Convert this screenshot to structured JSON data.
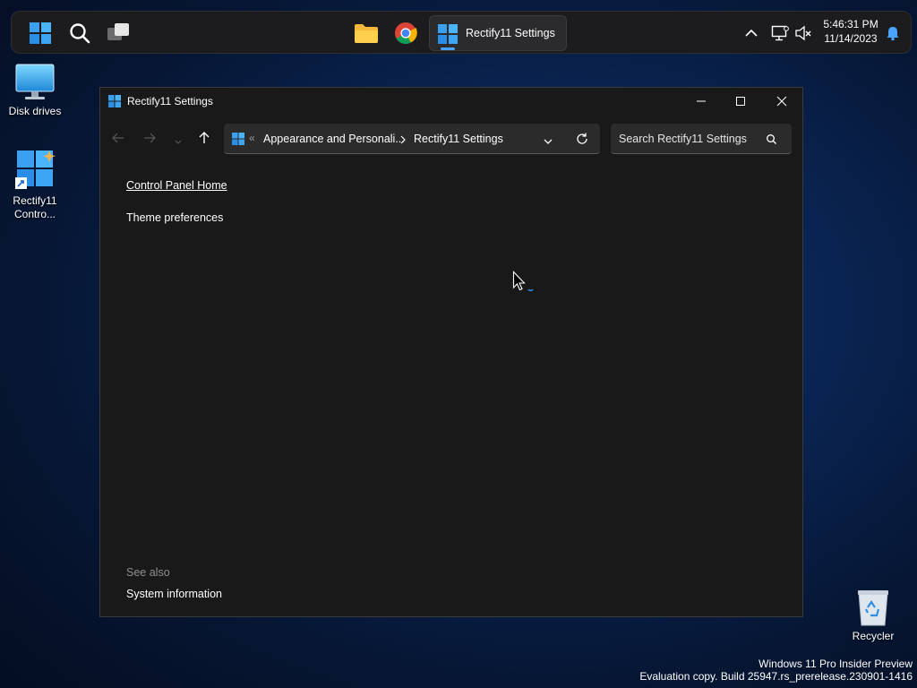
{
  "taskbar": {
    "active_app_label": "Rectify11 Settings",
    "clock_time": "5:46:31 PM",
    "clock_date": "11/14/2023"
  },
  "desktop": {
    "icons": [
      {
        "label": "Disk drives"
      },
      {
        "label_line1": "Rectify11",
        "label_line2": "Contro..."
      },
      {
        "label": "Recycler"
      }
    ]
  },
  "window": {
    "title": "Rectify11 Settings",
    "breadcrumb": [
      "Appearance and Personali...",
      "Rectify11 Settings"
    ],
    "search_placeholder": "Search Rectify11 Settings",
    "sidebar": {
      "home_link": "Control Panel Home",
      "items": [
        "Theme preferences"
      ],
      "see_also_heading": "See also",
      "see_also_items": [
        "System information"
      ]
    }
  },
  "watermark": {
    "line1": "Windows 11 Pro Insider Preview",
    "line2": "Evaluation copy. Build 25947.rs_prerelease.230901-1416"
  },
  "colors": {
    "accent": "#4aa3ff",
    "window_bg": "#191919",
    "taskbar_bg": "#1c1c1e"
  }
}
